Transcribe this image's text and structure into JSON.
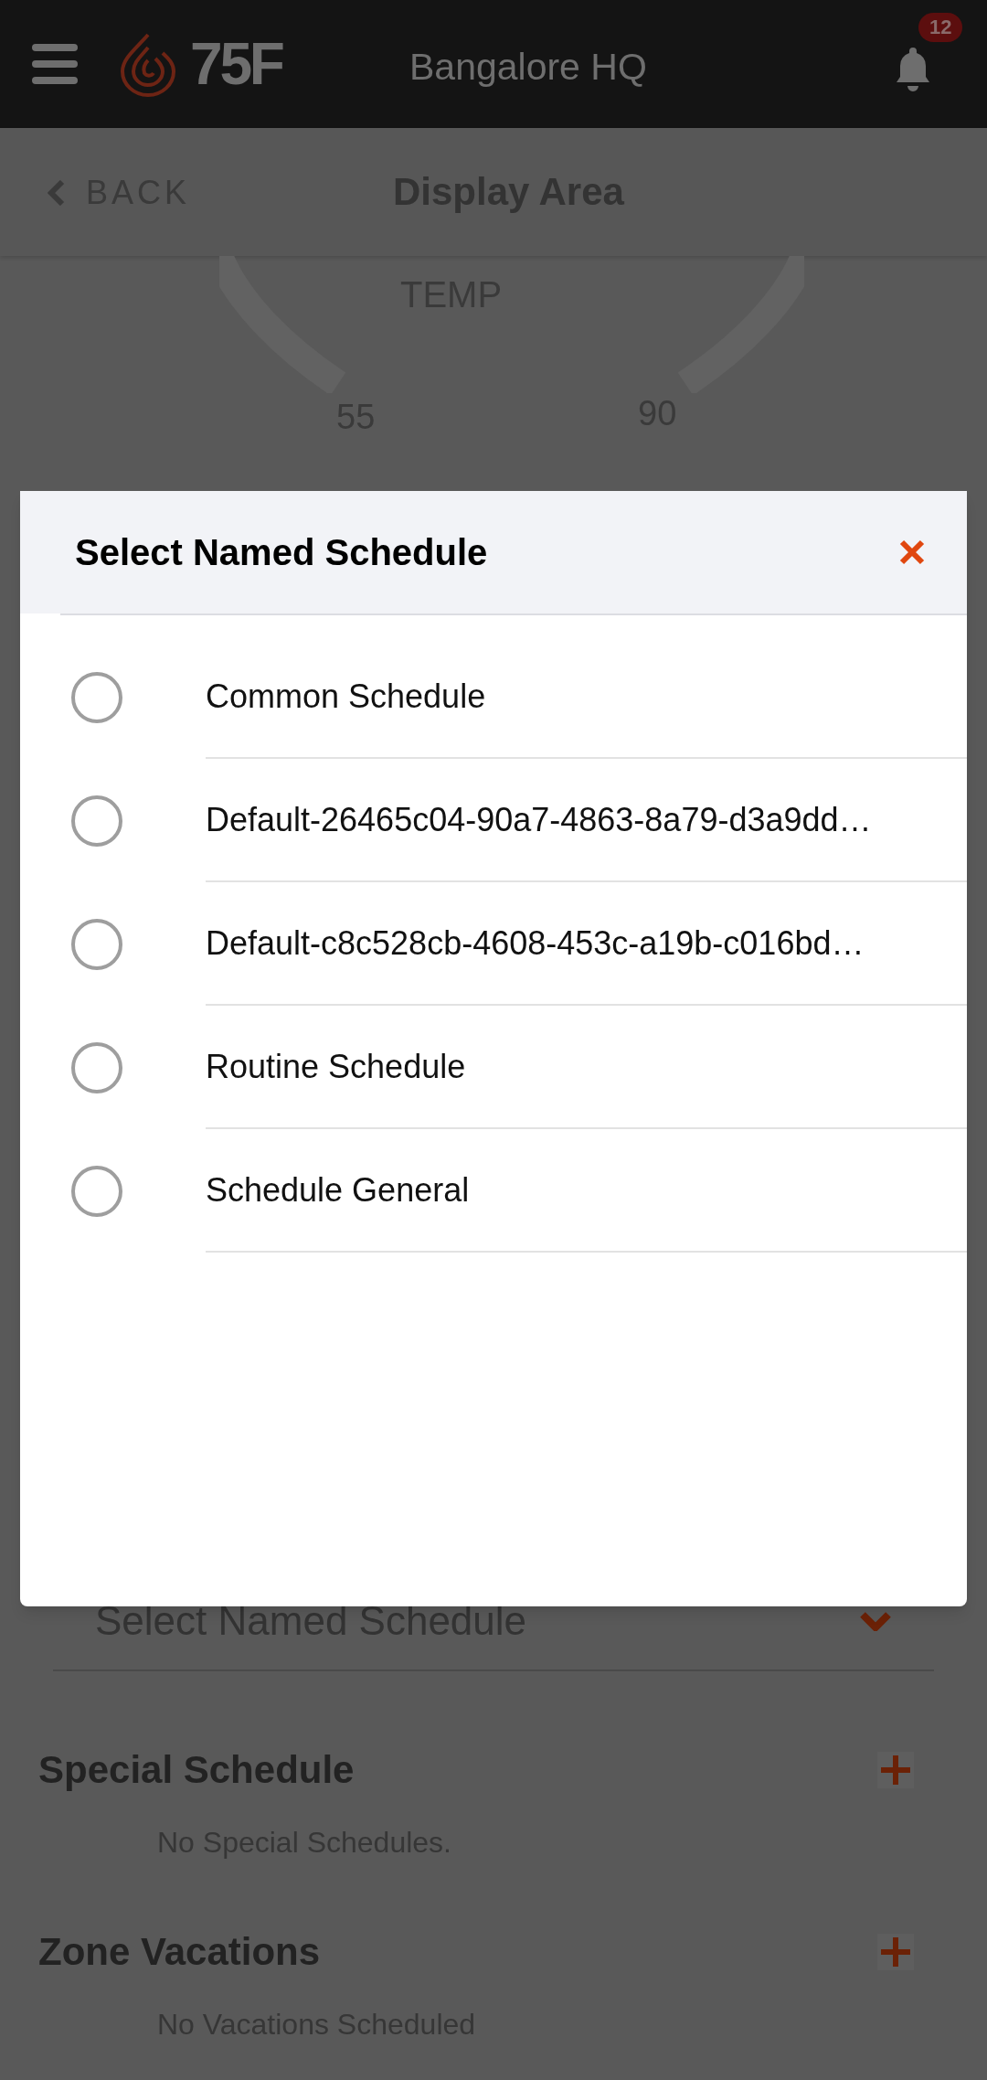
{
  "header": {
    "logo_text": "75F",
    "title": "Bangalore HQ",
    "notification_count": "12"
  },
  "subheader": {
    "back": "BACK",
    "title": "Display Area"
  },
  "gauge": {
    "label": "TEMP",
    "min": "55",
    "max": "90"
  },
  "schedule_dropdown": {
    "value": "Select Named Schedule"
  },
  "sections": [
    {
      "title": "Special Schedule",
      "empty_text": "No Special Schedules."
    },
    {
      "title": "Zone Vacations",
      "empty_text": "No Vacations Scheduled"
    }
  ],
  "dialog": {
    "title": "Select Named Schedule",
    "options": [
      {
        "label": "Common Schedule",
        "selected": false
      },
      {
        "label": "Default-26465c04-90a7-4863-8a79-d3a9dd…",
        "selected": false
      },
      {
        "label": "Default-c8c528cb-4608-453c-a19b-c016bd…",
        "selected": false
      },
      {
        "label": "Routine Schedule",
        "selected": false
      },
      {
        "label": "Schedule General",
        "selected": false
      }
    ]
  }
}
